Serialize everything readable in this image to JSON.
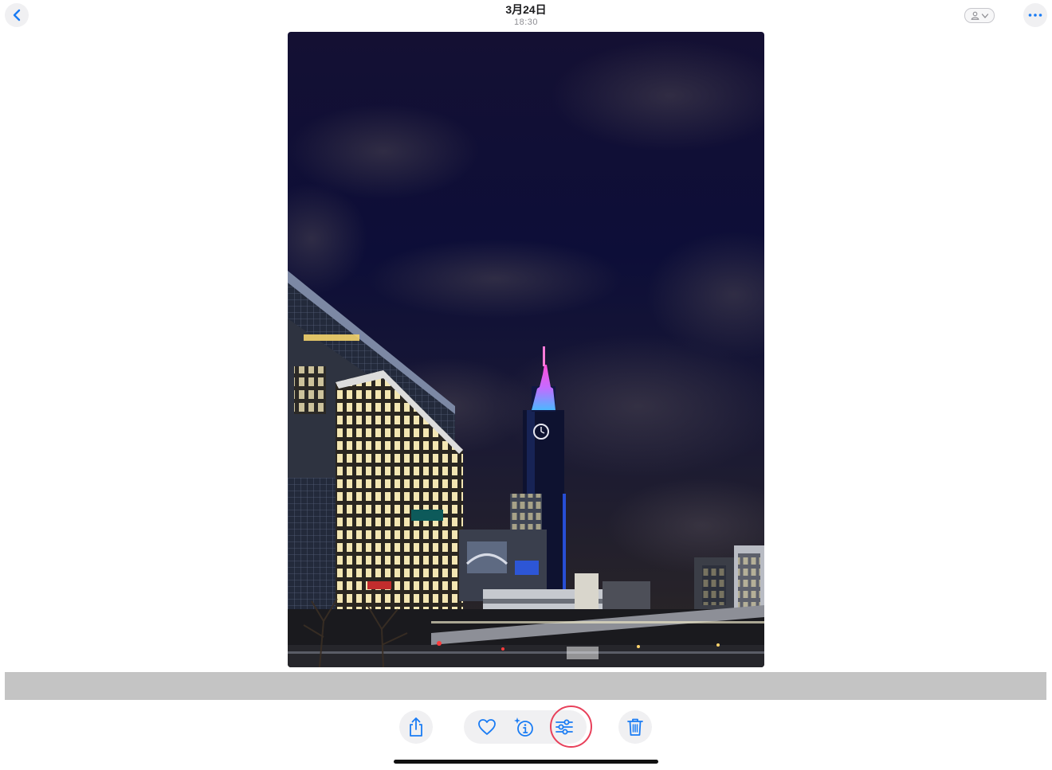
{
  "header": {
    "title": "3月24日",
    "subtitle": "18:30",
    "back_icon": "chevron-left-icon",
    "more_icon": "ellipsis-icon",
    "person_menu_icon": "person-chevron-down-icon"
  },
  "photo": {
    "icon": "night-cityscape-photo"
  },
  "toolbar": {
    "share_icon": "share-icon",
    "favorite_icon": "heart-icon",
    "info_icon": "sparkle-info-icon",
    "adjust_icon": "sliders-icon",
    "delete_icon": "trash-icon",
    "accent_color": "#1a7cf4",
    "highlight_color": "#e8405a"
  }
}
